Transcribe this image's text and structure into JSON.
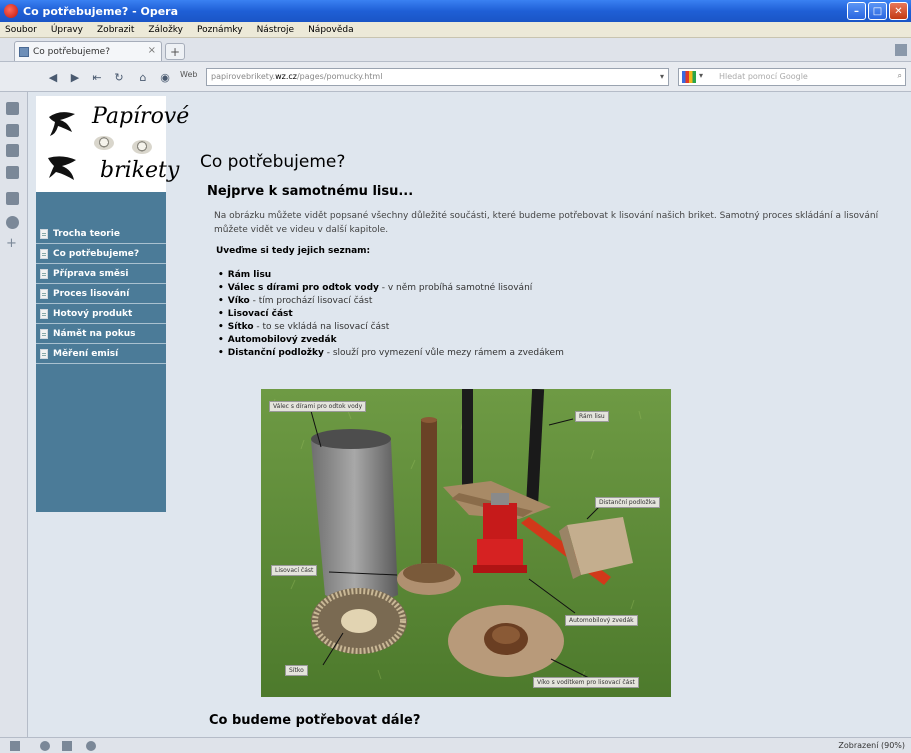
{
  "window": {
    "title": "Co potřebujeme? - Opera"
  },
  "menu": [
    "Soubor",
    "Úpravy",
    "Zobrazit",
    "Záložky",
    "Poznámky",
    "Nástroje",
    "Nápověda"
  ],
  "tab": {
    "label": "Co potřebujeme?",
    "close": "×",
    "new": "+"
  },
  "navbar": {
    "web_label": "Web",
    "url_prefix": "papirovebrikety.",
    "url_host": "wz.cz",
    "url_path": "/pages/pomucky.html",
    "search_placeholder": "Hledat pomocí Google"
  },
  "logo": {
    "line1": "Papírové",
    "line2": "brikety"
  },
  "nav": [
    "Trocha teorie",
    "Co potřebujeme?",
    "Příprava směsi",
    "Proces lisování",
    "Hotový produkt",
    "Námět na pokus",
    "Měření emisí"
  ],
  "content": {
    "title": "Co potřebujeme?",
    "section1_heading": "Nejprve k samotnému lisu...",
    "para": "Na obrázku můžete vidět popsané všechny důležité součásti, které budeme potřebovat k lisování našich briket. Samotný proces skládání a lisování můžete vidět ve videu v další kapitole.",
    "lead": "Uveďme si tedy jejich seznam:",
    "items": [
      {
        "name": "Rám lisu",
        "desc": ""
      },
      {
        "name": "Válec s dírami pro odtok vody",
        "desc": " - v něm probíhá samotné lisování"
      },
      {
        "name": "Víko",
        "desc": " - tím prochází lisovací část"
      },
      {
        "name": "Lisovací část",
        "desc": ""
      },
      {
        "name": "Sítko",
        "desc": " - to se vkládá na lisovací část"
      },
      {
        "name": "Automobilový zvedák",
        "desc": ""
      },
      {
        "name": "Distanční podložky",
        "desc": " - slouží pro vymezení vůle mezy rámem a zvedákem"
      }
    ],
    "captions": {
      "cylinder": "Válec s dírami pro odtok vody",
      "frame": "Rám lisu",
      "spacers": "Distanční podložka",
      "press": "Lisovací část",
      "jack": "Automobilový zvedák",
      "sieve": "Sítko",
      "lid": "Víko s vodítkem pro lisovací část"
    },
    "section2_heading": "Co budeme potřebovat dále?"
  },
  "status": {
    "zoom": "Zobrazení (90%)"
  },
  "colors": {
    "nav_bg": "#4b7b98",
    "page_bg": "#dfe6ee",
    "titlebar": "#1f5fd6"
  }
}
